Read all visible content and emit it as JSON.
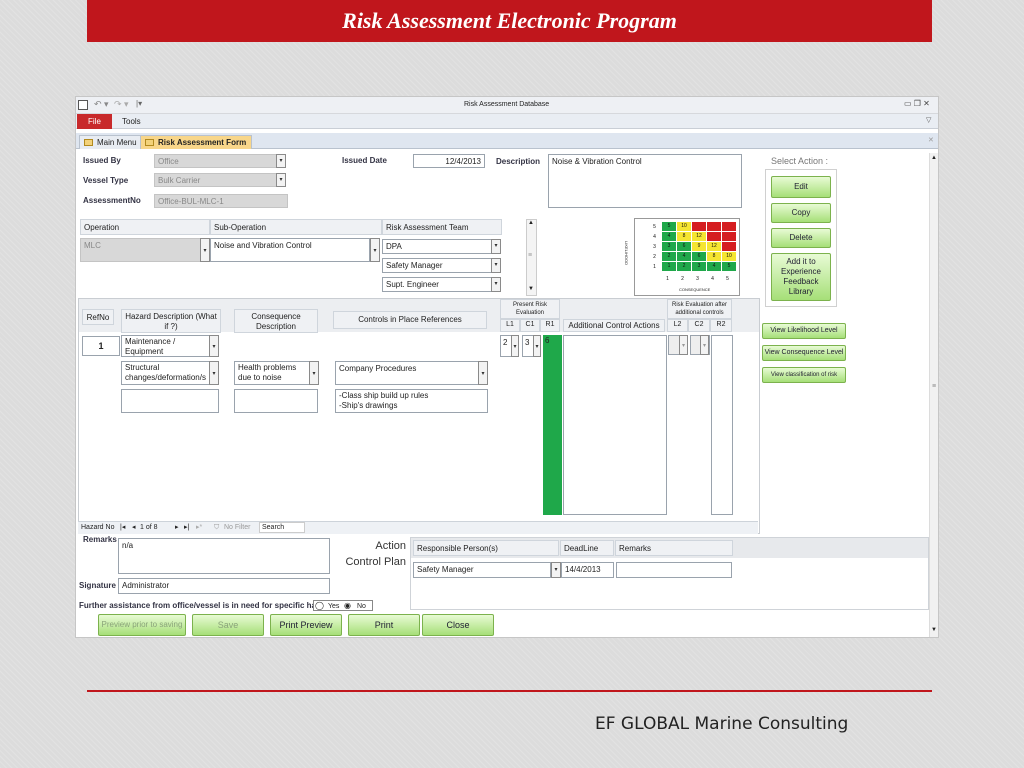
{
  "banner": {
    "title": "Risk Assessment Electronic Program"
  },
  "window": {
    "title": "Risk Assessment Database"
  },
  "ribbon": {
    "file": "File",
    "tools": "Tools"
  },
  "tabs": [
    {
      "label": "Main Menu"
    },
    {
      "label": "Risk Assessment Form"
    }
  ],
  "form": {
    "issued_by": {
      "label": "Issued By",
      "value": "Office"
    },
    "vessel_type": {
      "label": "Vessel Type",
      "value": "Bulk Carrier"
    },
    "assessment_no": {
      "label": "AssessmentNo",
      "value": "Office-BUL-MLC-1"
    },
    "issued_date": {
      "label": "Issued Date",
      "value": "12/4/2013"
    },
    "description": {
      "label": "Description",
      "value": "Noise & Vibration Control"
    },
    "operation": {
      "label": "Operation",
      "value": "MLC"
    },
    "sub_operation": {
      "label": "Sub-Operation",
      "value": "Noise and Vibration Control"
    },
    "team": {
      "label": "Risk Assessment Team",
      "members": [
        "DPA",
        "Safety Manager",
        "Supt. Engineer"
      ]
    }
  },
  "matrix": {
    "likelihood_label": "LIKELIHOOD",
    "consequence_label": "CONSEQUENCE",
    "rows": [
      {
        "l": "5",
        "cells": [
          "5",
          "10",
          "",
          "",
          ""
        ]
      },
      {
        "l": "4",
        "cells": [
          "4",
          "8",
          "12",
          "",
          ""
        ]
      },
      {
        "l": "3",
        "cells": [
          "3",
          "6",
          "9",
          "12",
          ""
        ]
      },
      {
        "l": "2",
        "cells": [
          "2",
          "4",
          "6",
          "8",
          "10"
        ]
      },
      {
        "l": "1",
        "cells": [
          "1",
          "2",
          "3",
          "4",
          "5"
        ]
      }
    ],
    "cols": [
      "1",
      "2",
      "3",
      "4",
      "5"
    ],
    "colors": [
      [
        "#1fa84a",
        "#f5e531",
        "#d51d20",
        "#d51d20",
        "#d51d20"
      ],
      [
        "#1fa84a",
        "#f5e531",
        "#f5e531",
        "#d51d20",
        "#d51d20"
      ],
      [
        "#1fa84a",
        "#1fa84a",
        "#f5e531",
        "#f5e531",
        "#d51d20"
      ],
      [
        "#1fa84a",
        "#1fa84a",
        "#1fa84a",
        "#f5e531",
        "#f5e531"
      ],
      [
        "#1fa84a",
        "#1fa84a",
        "#1fa84a",
        "#1fa84a",
        "#1fa84a"
      ]
    ]
  },
  "actions": {
    "title": "Select Action :",
    "edit": "Edit",
    "copy": "Copy",
    "delete": "Delete",
    "add_library": "Add it to Experience Feedback Library",
    "view_likelihood": "View Likelihood Level",
    "view_consequence": "View Consequence Level",
    "view_classification": "View classification of risk"
  },
  "hazard_table": {
    "headers": {
      "refno": "RefNo",
      "hazard": "Hazard Description (What if ?)",
      "consequence": "Consequence Description",
      "controls": "Controls in Place References",
      "present_risk": "Present Risk Evaluation",
      "l1": "L1",
      "c1": "C1",
      "r1": "R1",
      "additional": "Additional Control Actions",
      "after_risk": "Risk Evaluation after additional controls",
      "l2": "L2",
      "c2": "C2",
      "r2": "R2"
    },
    "row": {
      "refno": "1",
      "hazard1": "Maintenance / Equipment",
      "hazard2": "Structural changes/deformation/s",
      "consequence": "Health problems due to noise",
      "control": "Company Procedures",
      "control_refs": "-Class ship build up rules\n-Ship's drawings",
      "l1": "2",
      "c1": "3",
      "r1": "6",
      "r1_color": "#1fa84a"
    }
  },
  "nav": {
    "label": "Hazard No",
    "position": "1 of 8",
    "filter": "No Filter",
    "search": "Search"
  },
  "remarks": {
    "label": "Remarks",
    "value": "n/a"
  },
  "signature": {
    "label": "Signature",
    "value": "Administrator"
  },
  "assistance": {
    "question": "Further assistance from office/vessel is in need for specific hazard ?",
    "yes": "Yes",
    "no": "No"
  },
  "action_plan": {
    "title": "Action Control Plan",
    "responsible": "Responsible Person(s)",
    "deadline": "DeadLine",
    "remarks": "Remarks",
    "responsible_value": "Safety Manager",
    "deadline_value": "14/4/2013"
  },
  "bottom_buttons": {
    "preview": "Preview prior to saving",
    "save": "Save",
    "print_preview": "Print Preview",
    "print": "Print",
    "close": "Close"
  },
  "footer": {
    "company": "EF GLOBAL Marine Consulting"
  },
  "accent": "#c0161c"
}
